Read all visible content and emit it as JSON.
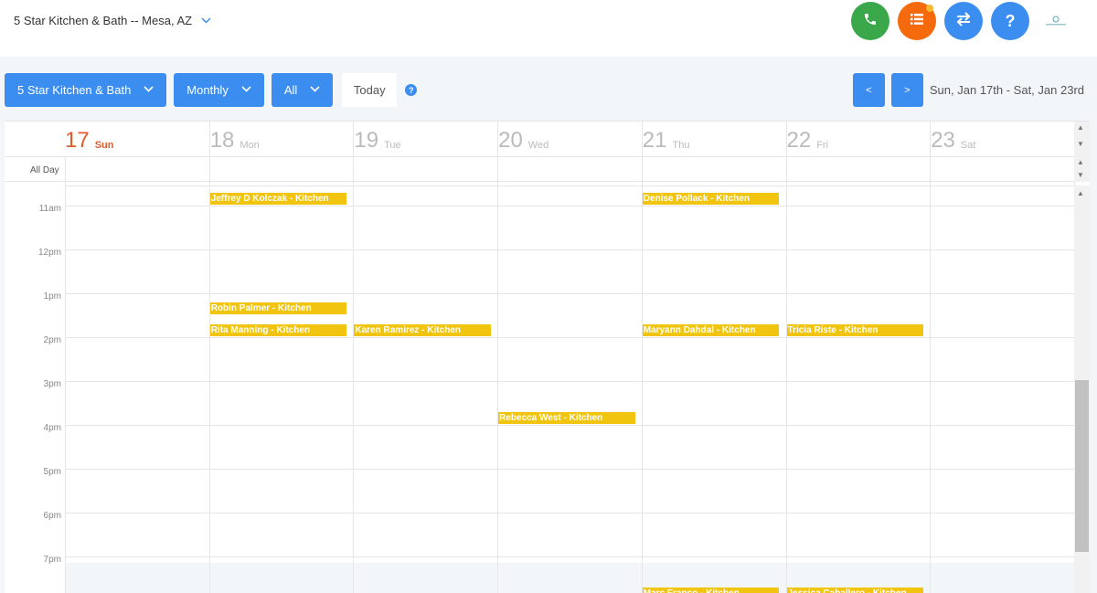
{
  "header": {
    "location": "5 Star Kitchen & Bath -- Mesa, AZ",
    "icons": [
      "phone-icon",
      "list-icon",
      "swap-icon",
      "help-icon"
    ],
    "colors": {
      "green": "#3aa74a",
      "orange": "#f56a0c",
      "blue": "#3b8ef0"
    }
  },
  "toolbar": {
    "company": "5 Star Kitchen & Bath",
    "view": "Monthly",
    "filter": "All",
    "today": "Today",
    "prev": "<",
    "next": ">",
    "range": "Sun, Jan 17th - Sat, Jan 23rd"
  },
  "calendar": {
    "days": [
      {
        "num": "17",
        "name": "Sun",
        "today": true
      },
      {
        "num": "18",
        "name": "Mon",
        "today": false
      },
      {
        "num": "19",
        "name": "Tue",
        "today": false
      },
      {
        "num": "20",
        "name": "Wed",
        "today": false
      },
      {
        "num": "21",
        "name": "Thu",
        "today": false
      },
      {
        "num": "22",
        "name": "Fri",
        "today": false
      },
      {
        "num": "23",
        "name": "Sat",
        "today": false
      }
    ],
    "allday_label": "All Day",
    "hours": [
      "11am",
      "12pm",
      "1pm",
      "2pm",
      "3pm",
      "4pm",
      "5pm",
      "6pm",
      "7pm"
    ],
    "events": [
      {
        "title": "Jeffrey D Kolczak - Kitchen",
        "day": 1,
        "hour": 10.7
      },
      {
        "title": "Denise Pollack - Kitchen",
        "day": 4,
        "hour": 10.7
      },
      {
        "title": "Robin Palmer - Kitchen",
        "day": 1,
        "hour": 13.2
      },
      {
        "title": "Rita Manning - Kitchen",
        "day": 1,
        "hour": 13.7
      },
      {
        "title": "Karen Ramirez - Kitchen",
        "day": 2,
        "hour": 13.7
      },
      {
        "title": "Maryann Dahdal - Kitchen",
        "day": 4,
        "hour": 13.7
      },
      {
        "title": "Tricia Riste - Kitchen",
        "day": 5,
        "hour": 13.7
      },
      {
        "title": "Rebecca West - Kitchen",
        "day": 3,
        "hour": 15.7
      },
      {
        "title": "Marc Franco - Kitchen",
        "day": 4,
        "hour": 19.7
      },
      {
        "title": "Jessica Caballero - Kitchen",
        "day": 5,
        "hour": 19.7
      }
    ],
    "event_color": "#f1c40f"
  }
}
